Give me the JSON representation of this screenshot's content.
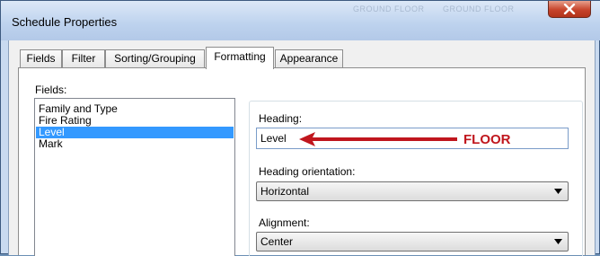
{
  "window": {
    "title": "Schedule Properties",
    "close_glyph": "X",
    "background_text": [
      "GROUND FLOOR",
      "GROUND FLOOR"
    ]
  },
  "tabs": [
    {
      "label": "Fields"
    },
    {
      "label": "Filter"
    },
    {
      "label": "Sorting/Grouping"
    },
    {
      "label": "Formatting",
      "active": true
    },
    {
      "label": "Appearance"
    }
  ],
  "fields": {
    "label": "Fields:",
    "items": [
      "Family and Type",
      "Fire Rating",
      "Level",
      "Mark"
    ],
    "selected": "Level"
  },
  "formatting": {
    "heading_label": "Heading:",
    "heading_value": "Level",
    "orientation_label": "Heading orientation:",
    "orientation_value": "Horizontal",
    "alignment_label": "Alignment:",
    "alignment_value": "Center"
  },
  "annotation": {
    "text": "FLOOR",
    "color": "#c0161d",
    "icon": "arrow-left-icon"
  },
  "colors": {
    "selection": "#3399ff",
    "close_button": "#c7442b"
  }
}
